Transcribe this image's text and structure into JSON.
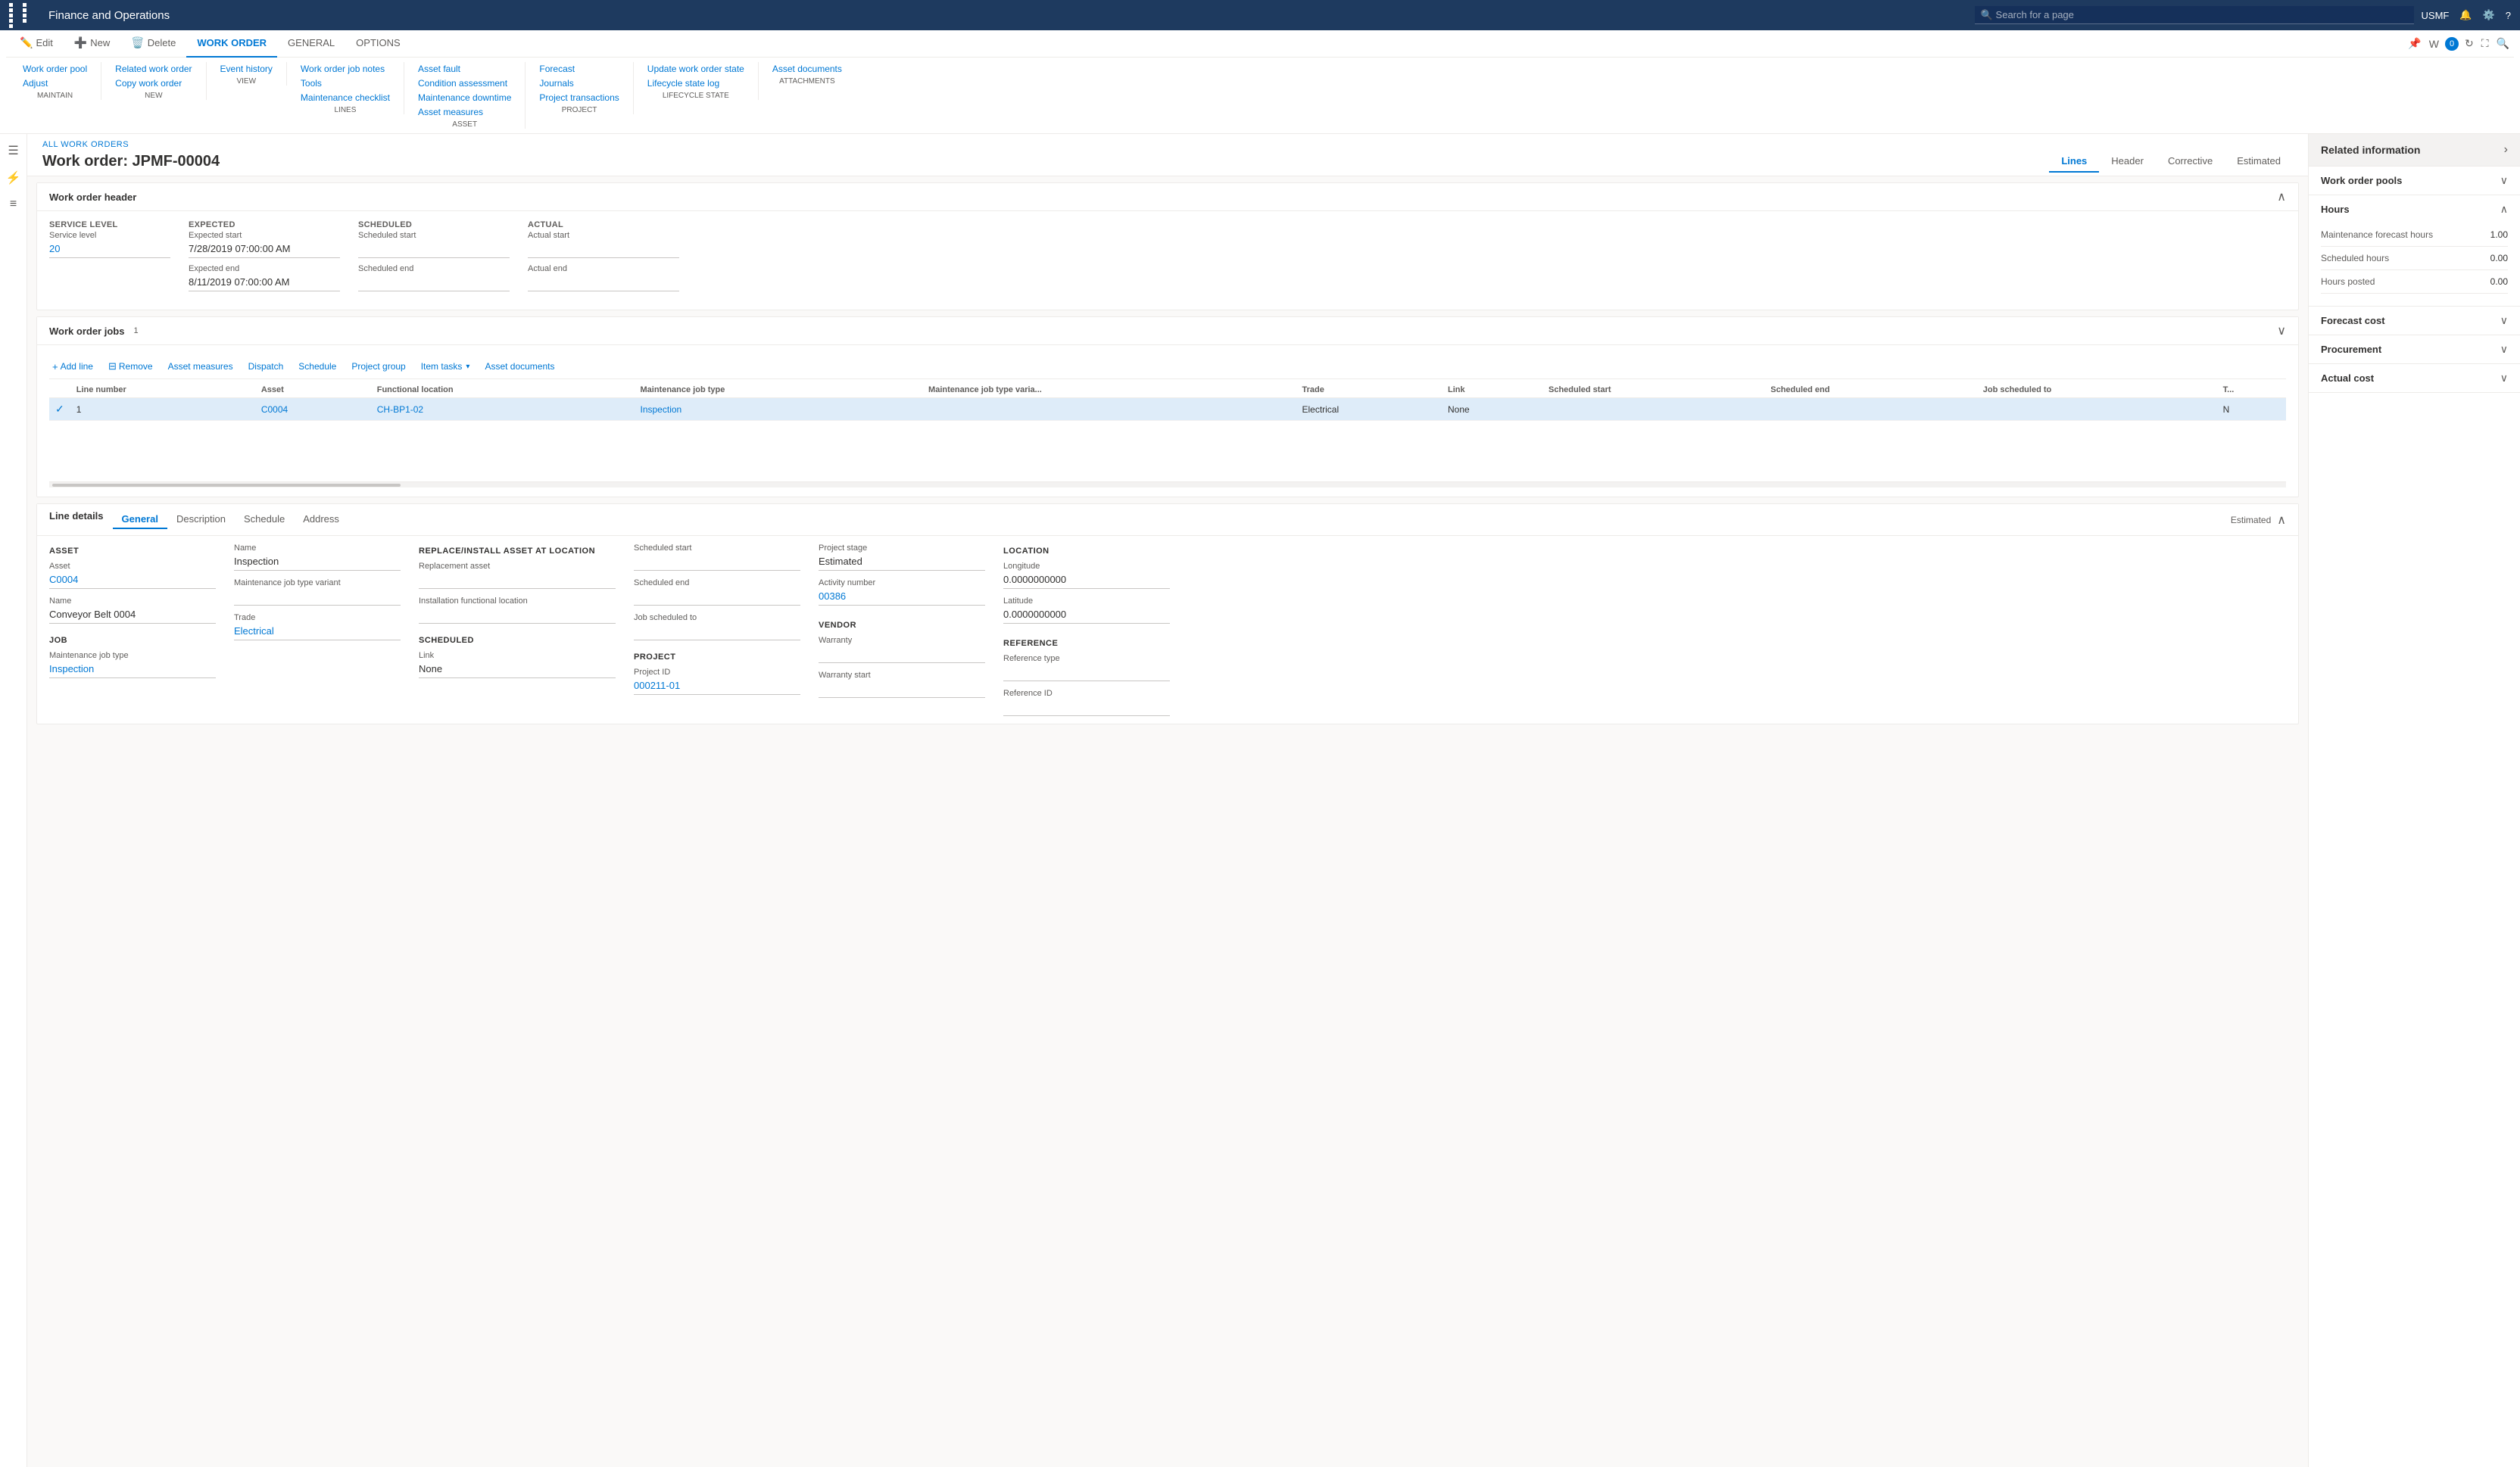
{
  "app": {
    "title": "Finance and Operations",
    "user": "USMF"
  },
  "search": {
    "placeholder": "Search for a page"
  },
  "ribbon": {
    "tabs": [
      {
        "id": "edit",
        "label": "Edit",
        "icon": "✏️",
        "active": false
      },
      {
        "id": "new",
        "label": "New",
        "icon": "➕",
        "active": false
      },
      {
        "id": "delete",
        "label": "Delete",
        "icon": "🗑️",
        "active": false
      },
      {
        "id": "work-order",
        "label": "WORK ORDER",
        "active": true
      },
      {
        "id": "general",
        "label": "GENERAL",
        "active": false
      },
      {
        "id": "options",
        "label": "OPTIONS",
        "active": false
      }
    ],
    "groups": {
      "maintain": {
        "label": "MAINTAIN",
        "items": [
          "Work order pool",
          "Adjust"
        ]
      },
      "new": {
        "label": "NEW",
        "items": [
          "Related work order",
          "Copy work order"
        ]
      },
      "view": {
        "label": "VIEW",
        "items": [
          "Event history"
        ]
      },
      "lines": {
        "label": "LINES",
        "items": [
          "Work order job notes",
          "Tools",
          "Maintenance checklist"
        ]
      },
      "asset": {
        "label": "ASSET",
        "items": [
          "Asset fault",
          "Condition assessment",
          "Maintenance downtime",
          "Asset measures"
        ]
      },
      "project": {
        "label": "PROJECT",
        "items": [
          "Forecast",
          "Journals",
          "Project transactions"
        ]
      },
      "lifecycle_state": {
        "label": "LIFECYCLE STATE",
        "items": [
          "Update work order state",
          "Lifecycle state log"
        ]
      },
      "attachments": {
        "label": "ATTACHMENTS",
        "items": [
          "Asset documents"
        ]
      }
    }
  },
  "page": {
    "breadcrumb": "ALL WORK ORDERS",
    "title": "Work order: JPMF-00004",
    "tabs": [
      {
        "label": "Lines",
        "active": true
      },
      {
        "label": "Header",
        "active": false
      },
      {
        "label": "Corrective",
        "active": false
      },
      {
        "label": "Estimated",
        "active": false
      }
    ]
  },
  "work_order_header": {
    "title": "Work order header",
    "sections": {
      "service_level": {
        "label": "SERVICE LEVEL",
        "sublabel": "Service level",
        "value": "20"
      },
      "expected": {
        "label": "EXPECTED",
        "start_label": "Expected start",
        "start_value": "7/28/2019 07:00:00 AM",
        "end_label": "Expected end",
        "end_value": "8/11/2019 07:00:00 AM"
      },
      "scheduled": {
        "label": "SCHEDULED",
        "start_label": "Scheduled start",
        "end_label": "Scheduled end"
      },
      "actual": {
        "label": "ACTUAL",
        "start_label": "Actual start",
        "end_label": "Actual end"
      }
    }
  },
  "work_order_jobs": {
    "title": "Work order jobs",
    "count": "1",
    "toolbar": {
      "add_line": "Add line",
      "remove": "Remove",
      "asset_measures": "Asset measures",
      "dispatch": "Dispatch",
      "schedule": "Schedule",
      "project_group": "Project group",
      "item_tasks": "Item tasks",
      "asset_documents": "Asset documents"
    },
    "columns": [
      "Line number",
      "Asset",
      "Functional location",
      "Maintenance job type",
      "Maintenance job type varia...",
      "Trade",
      "Link",
      "Scheduled start",
      "Scheduled end",
      "Job scheduled to",
      "T..."
    ],
    "rows": [
      {
        "checked": true,
        "line_number": "1",
        "asset": "C0004",
        "functional_location": "CH-BP1-02",
        "maintenance_job_type": "Inspection",
        "maintenance_job_type_variant": "",
        "trade": "Electrical",
        "link": "None",
        "scheduled_start": "",
        "scheduled_end": "",
        "job_scheduled_to": "",
        "t": "N"
      }
    ]
  },
  "line_details": {
    "title": "Line details",
    "estimated_label": "Estimated",
    "tabs": [
      {
        "label": "General",
        "active": true
      },
      {
        "label": "Description",
        "active": false
      },
      {
        "label": "Schedule",
        "active": false
      },
      {
        "label": "Address",
        "active": false
      }
    ],
    "asset_section": {
      "label": "ASSET",
      "asset_label": "Asset",
      "asset_value": "C0004",
      "name_label": "Name",
      "name_value": "Conveyor Belt 0004"
    },
    "job_section": {
      "label": "JOB",
      "maintenance_job_type_label": "Maintenance job type",
      "maintenance_job_type_value": "Inspection"
    },
    "name_section": {
      "name_label": "Name",
      "name_value": "Inspection",
      "maintenance_job_type_variant_label": "Maintenance job type variant",
      "trade_label": "Trade",
      "trade_value": "Electrical"
    },
    "replace_section": {
      "label": "REPLACE/INSTALL ASSET AT LOCATION",
      "replacement_asset_label": "Replacement asset",
      "installation_functional_location_label": "Installation functional location"
    },
    "scheduled_section": {
      "label": "SCHEDULED",
      "link_label": "Link",
      "link_value": "None"
    },
    "project_section": {
      "label": "PROJECT",
      "project_id_label": "Project ID",
      "project_id_value": "000211-01"
    },
    "times_section": {
      "scheduled_start_label": "Scheduled start",
      "scheduled_end_label": "Scheduled end",
      "job_scheduled_to_label": "Job scheduled to"
    },
    "project_stage_section": {
      "project_stage_label": "Project stage",
      "project_stage_value": "Estimated",
      "activity_number_label": "Activity number",
      "activity_number_value": "00386"
    },
    "vendor_section": {
      "label": "VENDOR",
      "warranty_label": "Warranty",
      "warranty_start_label": "Warranty start"
    },
    "location_section": {
      "label": "LOCATION",
      "longitude_label": "Longitude",
      "longitude_value": "0.0000000000",
      "latitude_label": "Latitude",
      "latitude_value": "0.0000000000"
    },
    "reference_section": {
      "label": "REFERENCE",
      "reference_type_label": "Reference type",
      "reference_id_label": "Reference ID"
    }
  },
  "right_panel": {
    "title": "Related information",
    "sections": [
      {
        "id": "work-order-pools",
        "title": "Work order pools",
        "expanded": false
      },
      {
        "id": "hours",
        "title": "Hours",
        "expanded": true,
        "fields": [
          {
            "label": "Maintenance forecast hours",
            "value": "1.00"
          },
          {
            "label": "Scheduled hours",
            "value": "0.00"
          },
          {
            "label": "Hours posted",
            "value": "0.00"
          }
        ]
      },
      {
        "id": "forecast-cost",
        "title": "Forecast cost",
        "expanded": false
      },
      {
        "id": "procurement",
        "title": "Procurement",
        "expanded": false
      },
      {
        "id": "actual-cost",
        "title": "Actual cost",
        "expanded": false
      }
    ]
  }
}
